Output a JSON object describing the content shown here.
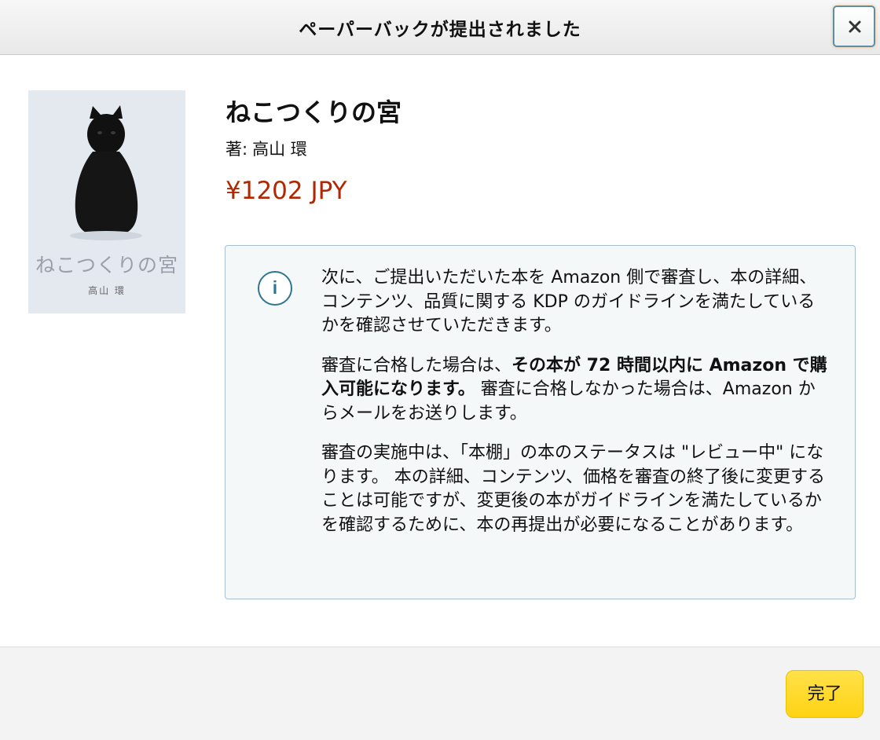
{
  "dialog": {
    "title": "ペーパーバックが提出されました",
    "close_label": "×"
  },
  "book": {
    "cover": {
      "title": "ねこつくりの宮",
      "author": "高山 環"
    },
    "title": "ねこつくりの宮",
    "author_prefix": "著:",
    "author": "高山 環",
    "price": "¥1202 JPY"
  },
  "notice": {
    "icon": "info-icon",
    "icon_glyph": "i",
    "paragraph1": "次に、ご提出いただいた本を Amazon 側で審査し、本の詳細、コンテンツ、品質に関する KDP のガイドラインを満たしているかを確認させていただきます。",
    "paragraph2_lead": "審査に合格した場合は、",
    "paragraph2_bold": "その本が 72 時間以内に Amazon で購入可能になります。",
    "paragraph2_tail": " 審査に合格しなかった場合は、Amazon からメールをお送りします。",
    "paragraph3": "審査の実施中は、「本棚」の本のステータスは \"レビュー中\" になります。 本の詳細、コンテンツ、価格を審査の終了後に変更することは可能ですが、変更後の本がガイドラインを満たしているかを確認するために、本の再提出が必要になることがあります。"
  },
  "footer": {
    "done_label": "完了"
  },
  "colors": {
    "price": "#b12704",
    "info_accent": "#2e7592",
    "done_button": "#ffd313"
  }
}
